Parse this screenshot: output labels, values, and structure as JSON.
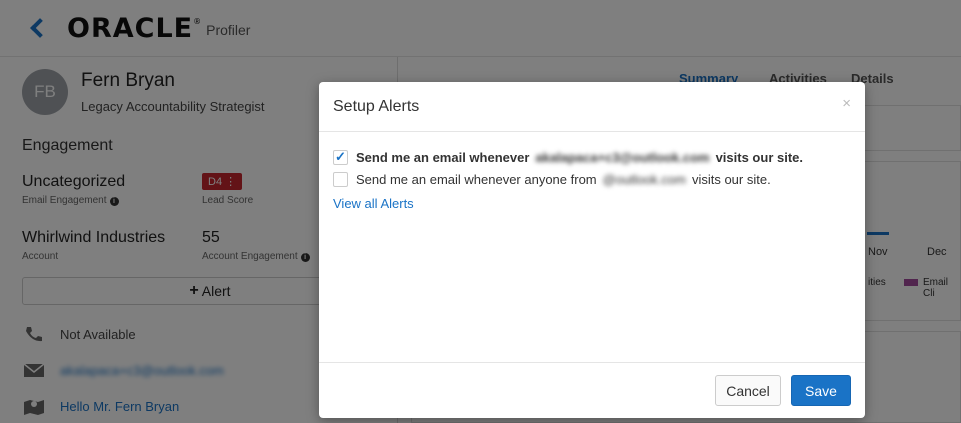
{
  "header": {
    "logo": "ORACLE",
    "product": "Profiler"
  },
  "profile": {
    "initials": "FB",
    "name": "Fern Bryan",
    "title": "Legacy Accountability Strategist",
    "engagement_heading": "Engagement",
    "email_engagement": {
      "value": "Uncategorized",
      "label": "Email Engagement"
    },
    "lead_score": {
      "value": "D4",
      "label": "Lead Score"
    },
    "account": {
      "value": "Whirlwind Industries",
      "label": "Account"
    },
    "account_engagement": {
      "value": "55",
      "label": "Account Engagement"
    },
    "alert_button": "Alert",
    "phone": "Not Available",
    "email": "akalapaca+c3@outlook.com",
    "address": "Hello Mr. Fern Bryan"
  },
  "right": {
    "tabs": [
      "Summary",
      "Activities",
      "Details"
    ],
    "chart_months": [
      "Nov",
      "Dec"
    ],
    "legend": [
      "ities",
      "Email Cli"
    ]
  },
  "modal": {
    "title": "Setup Alerts",
    "close": "×",
    "option1_prefix": "Send me an email whenever",
    "option1_blurred": "akalapaca+c3@outlook.com",
    "option1_suffix": "visits our site.",
    "option2_prefix": "Send me an email whenever anyone from",
    "option2_blurred": "@outlook.com",
    "option2_suffix": "visits our site.",
    "view_all": "View all Alerts",
    "cancel": "Cancel",
    "save": "Save"
  },
  "colors": {
    "accent": "#1a73c6",
    "badge": "#c7272f",
    "legend_email": "#a34a9c"
  }
}
